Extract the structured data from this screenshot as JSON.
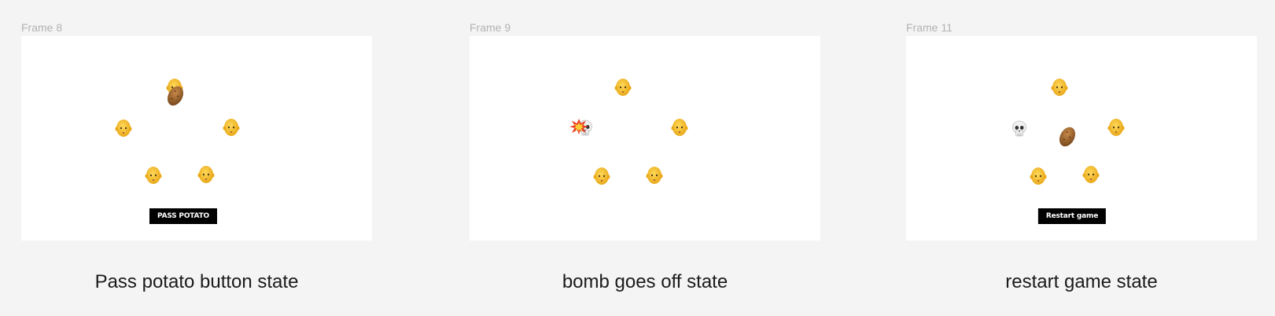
{
  "frames": [
    {
      "label": "Frame 8",
      "caption": "Pass potato button state",
      "button_label": "PASS POTATO",
      "players": 5,
      "potato_holder": "top"
    },
    {
      "label": "Frame 9",
      "caption": "bomb goes off state",
      "players": 5,
      "exploded_player": "left"
    },
    {
      "label": "Frame 11",
      "caption": "restart game state",
      "button_label": "Restart game",
      "players": 5,
      "dead_player": "left",
      "potato_state": "center"
    }
  ],
  "colors": {
    "canvas": "#f4f4f4",
    "frame_bg": "#ffffff",
    "button_bg": "#000000",
    "button_text": "#ffffff",
    "face": "#f7c232"
  },
  "icons": {
    "player": "person-face-icon",
    "potato": "potato-icon",
    "skull": "skull-icon",
    "explosion": "explosion-icon"
  }
}
